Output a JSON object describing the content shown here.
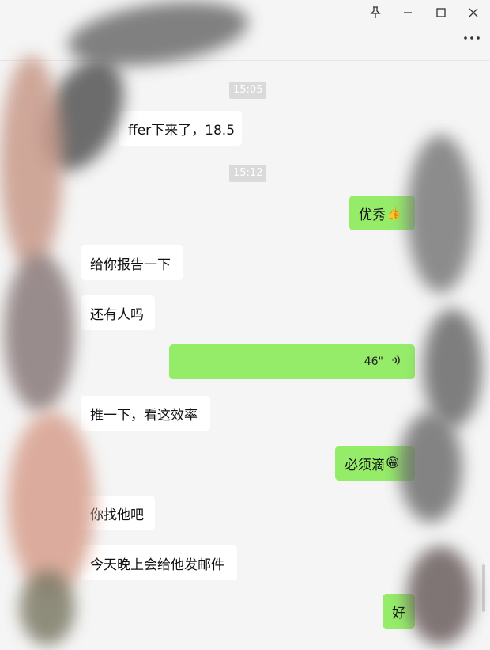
{
  "window": {
    "pin_icon": "pin-icon",
    "minimize_icon": "minimize-icon",
    "maximize_icon": "maximize-icon",
    "close_icon": "close-icon",
    "more_icon": "more-icon"
  },
  "messages": [
    {
      "kind": "time",
      "text": "15:05"
    },
    {
      "kind": "in",
      "text": "ffer下来了，18.5"
    },
    {
      "kind": "time",
      "text": "15:12"
    },
    {
      "kind": "out",
      "text": "优秀",
      "emoji": "👍"
    },
    {
      "kind": "in",
      "text": "给你报告一下"
    },
    {
      "kind": "in",
      "text": "还有人吗"
    },
    {
      "kind": "voice",
      "duration": "46\""
    },
    {
      "kind": "in",
      "text": "推一下，看这效率"
    },
    {
      "kind": "out",
      "text": "必须滴",
      "emoji": "😁"
    },
    {
      "kind": "in",
      "text": "你找他吧"
    },
    {
      "kind": "in",
      "text": "今天晚上会给他发邮件"
    },
    {
      "kind": "out",
      "text": "好"
    }
  ],
  "colors": {
    "outgoing_bubble": "#95ec69",
    "incoming_bubble": "#ffffff",
    "background": "#f5f5f5"
  }
}
